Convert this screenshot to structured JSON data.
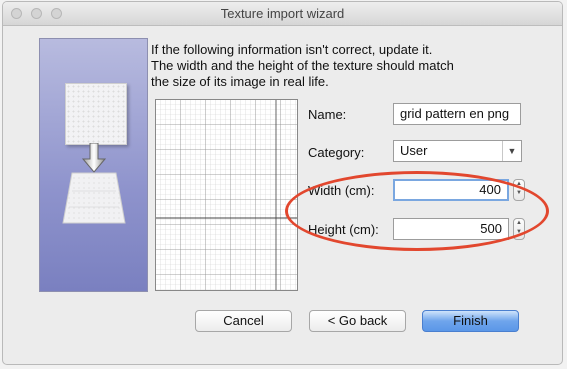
{
  "window": {
    "title": "Texture import wizard"
  },
  "instructions": [
    "If the following information isn't correct, update it.",
    "The width and the height of the texture should match",
    "the size of its image in real life."
  ],
  "form": {
    "name_label": "Name:",
    "name_value": "grid pattern en png",
    "category_label": "Category:",
    "category_value": "User",
    "width_label": "Width (cm):",
    "width_value": "400",
    "height_label": "Height (cm):",
    "height_value": "500"
  },
  "buttons": {
    "cancel": "Cancel",
    "back": "< Go back",
    "finish": "Finish"
  },
  "colors": {
    "annotation_oval": "#e2472e",
    "focus_ring": "#7aa7e0",
    "default_button": "#5b97e8",
    "side_panel": "#8e93cc"
  }
}
